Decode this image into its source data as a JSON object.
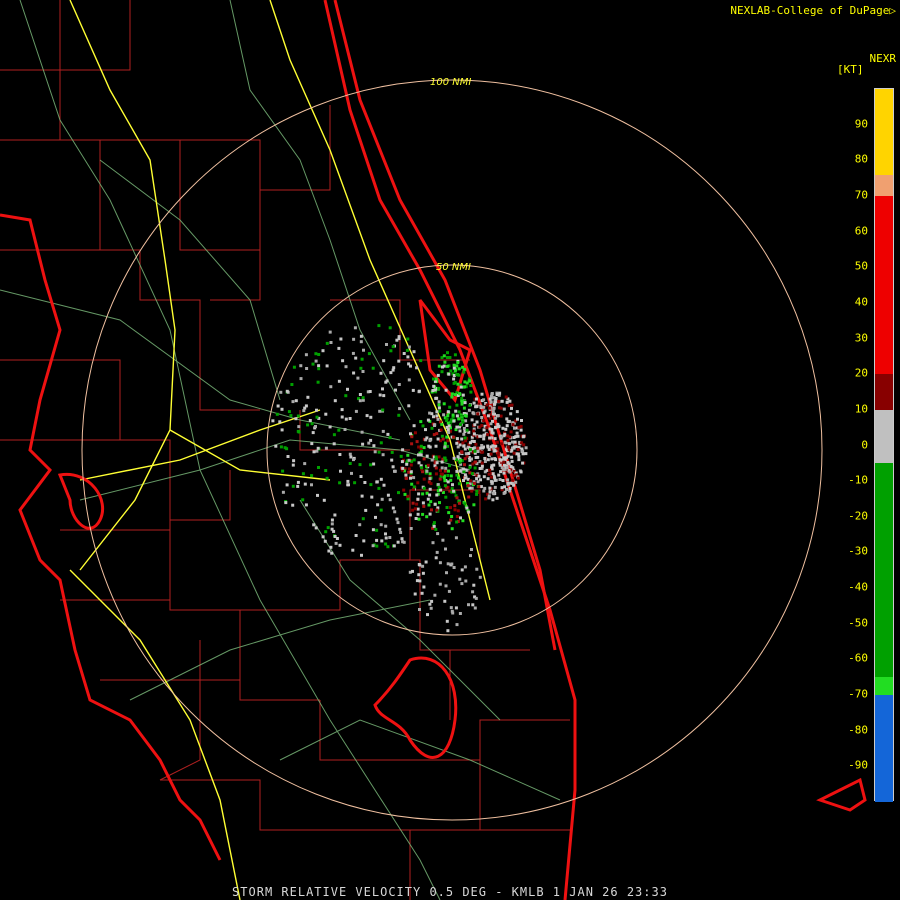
{
  "header": {
    "credit": "NEXLAB-College of DuPage"
  },
  "footer": {
    "product": "STORM RELATIVE VELOCITY 0.5 DEG - KMLB 1 JAN 26 23:33"
  },
  "legend": {
    "product": "NEXR",
    "unit": "[KT]",
    "ticks": [
      "90",
      "80",
      "70",
      "60",
      "50",
      "40",
      "30",
      "20",
      "10",
      "0",
      "-10",
      "-20",
      "-30",
      "-40",
      "-50",
      "-60",
      "-70",
      "-80",
      "-90"
    ],
    "scale": [
      {
        "from": 100,
        "to": 70,
        "color": "#ffd400"
      },
      {
        "from": 76,
        "to": 70,
        "color": "#f0a070"
      },
      {
        "from": 70,
        "to": 20,
        "color": "#ee0000"
      },
      {
        "from": 20,
        "to": 10,
        "color": "#880000"
      },
      {
        "from": 10,
        "to": -5,
        "color": "#c0c0c0"
      },
      {
        "from": -5,
        "to": -65,
        "color": "#00a000"
      },
      {
        "from": -65,
        "to": -70,
        "color": "#22dd22"
      },
      {
        "from": -70,
        "to": -100,
        "color": "#1466d8"
      }
    ]
  },
  "map": {
    "range_rings": [
      {
        "label": "100 NMI"
      },
      {
        "label": "50 NMI"
      }
    ],
    "colors": {
      "coast": "#ee1111",
      "county": "#bb2222",
      "roads_major": "#ffff33",
      "roads_minor": "#88cc88",
      "ring": "#f0c0a0"
    }
  }
}
